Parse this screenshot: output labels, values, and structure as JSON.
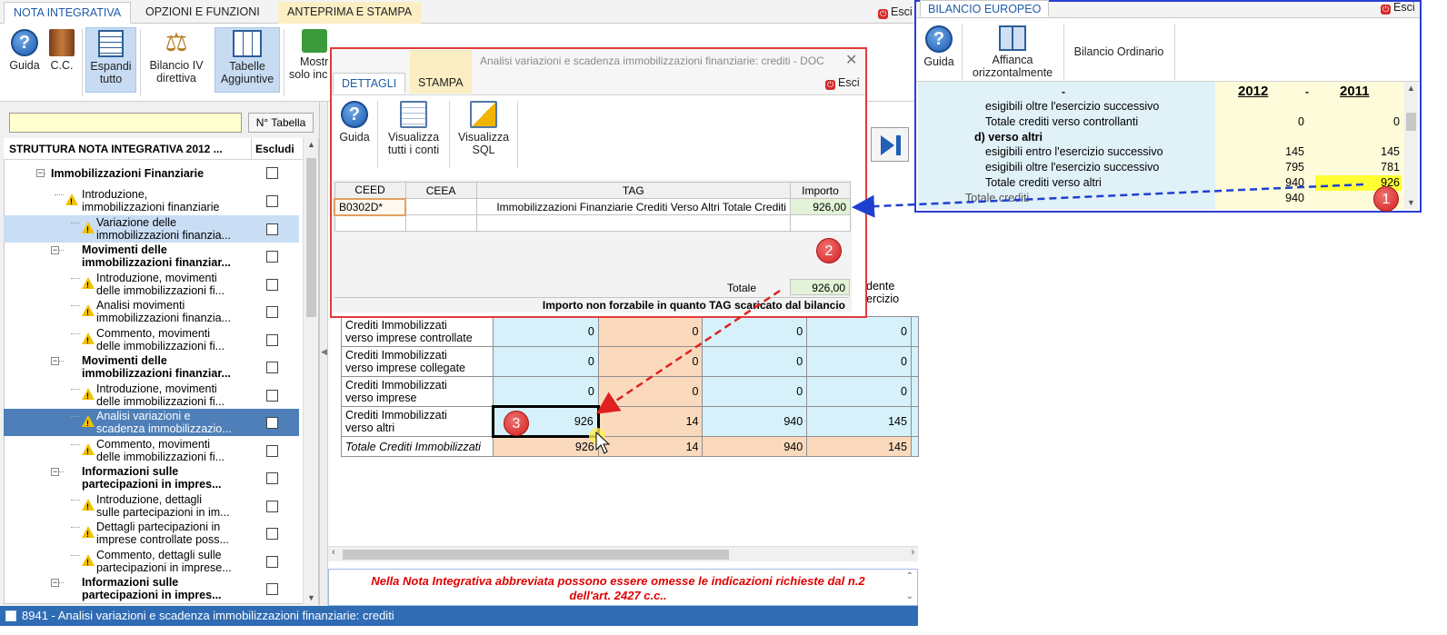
{
  "main": {
    "tabs": [
      "NOTA INTEGRATIVA",
      "OPZIONI E FUNZIONI",
      "ANTEPRIMA E STAMPA"
    ],
    "esci": "Esci",
    "ribbon": {
      "guida": "Guida",
      "cc": "C.C.",
      "espandi_l1": "Espandi",
      "espandi_l2": "tutto",
      "bilancio_l1": "Bilancio IV",
      "bilancio_l2": "direttiva",
      "tabelle_l1": "Tabelle",
      "tabelle_l2": "Aggiuntive",
      "mostra_l1": "Mostr",
      "mostra_l2": "solo inc"
    }
  },
  "tree": {
    "search_placeholder": "",
    "ntabella_label": "N° Tabella",
    "header_title": "STRUTTURA NOTA INTEGRATIVA 2012 ...",
    "header_escludi": "Escludi",
    "items": [
      {
        "l1": "Immobilizzazioni Finanziarie",
        "l2": "",
        "level": 1,
        "bold": true,
        "warn": false
      },
      {
        "l1": "Introduzione,",
        "l2": "immobilizzazioni finanziarie",
        "level": 2,
        "bold": false,
        "warn": true
      },
      {
        "l1": "Variazione delle",
        "l2": "immobilizzazioni finanzia...",
        "level": 3,
        "bold": false,
        "warn": true
      },
      {
        "l1": "Movimenti delle",
        "l2": "immobilizzazioni finanziar...",
        "level": 2,
        "bold": true,
        "warn": false
      },
      {
        "l1": "Introduzione, movimenti",
        "l2": "delle immobilizzazioni fi...",
        "level": 3,
        "bold": false,
        "warn": true
      },
      {
        "l1": "Analisi movimenti",
        "l2": "immobilizzazioni finanzia...",
        "level": 3,
        "bold": false,
        "warn": true
      },
      {
        "l1": "Commento, movimenti",
        "l2": "delle immobilizzazioni fi...",
        "level": 3,
        "bold": false,
        "warn": true
      },
      {
        "l1": "Movimenti delle",
        "l2": "immobilizzazioni finanziar...",
        "level": 2,
        "bold": true,
        "warn": false
      },
      {
        "l1": "Introduzione, movimenti",
        "l2": "delle immobilizzazioni fi...",
        "level": 3,
        "bold": false,
        "warn": true
      },
      {
        "l1": "Analisi variazioni e",
        "l2": "scadenza immobilizzazio...",
        "level": 3,
        "bold": false,
        "warn": true
      },
      {
        "l1": "Commento, movimenti",
        "l2": "delle immobilizzazioni fi...",
        "level": 3,
        "bold": false,
        "warn": true
      },
      {
        "l1": "Informazioni sulle",
        "l2": "partecipazioni  in  impres...",
        "level": 2,
        "bold": true,
        "warn": false
      },
      {
        "l1": "Introduzione, dettagli",
        "l2": "sulle partecipazioni in im...",
        "level": 3,
        "bold": false,
        "warn": true
      },
      {
        "l1": "Dettagli partecipazioni in",
        "l2": "imprese controllate poss...",
        "level": 3,
        "bold": false,
        "warn": true
      },
      {
        "l1": "Commento, dettagli sulle",
        "l2": "partecipazioni in imprese...",
        "level": 3,
        "bold": false,
        "warn": true
      },
      {
        "l1": "Informazioni sulle",
        "l2": "partecipazioni  in  impres...",
        "level": 2,
        "bold": true,
        "warn": false
      }
    ]
  },
  "credits_table": {
    "partial_header_l1": "dente",
    "partial_header_l2": "ercizio",
    "rows": [
      {
        "label_l1": "Crediti Immobilizzati",
        "label_l2": "verso imprese controllate",
        "c1": "0",
        "c2": "0",
        "c3": "0",
        "c4": "0"
      },
      {
        "label_l1": "Crediti Immobilizzati",
        "label_l2": "verso imprese collegate",
        "c1": "0",
        "c2": "0",
        "c3": "0",
        "c4": "0"
      },
      {
        "label_l1": "Crediti Immobilizzati",
        "label_l2": "verso imprese",
        "c1": "0",
        "c2": "0",
        "c3": "0",
        "c4": "0"
      },
      {
        "label_l1": "Crediti Immobilizzati",
        "label_l2": "verso altri",
        "c1": "926",
        "c2": "14",
        "c3": "940",
        "c4": "145"
      },
      {
        "label_l1": "Totale Crediti Immobilizzati",
        "label_l2": "",
        "c1": "926",
        "c2": "14",
        "c3": "940",
        "c4": "145"
      }
    ]
  },
  "note": {
    "line1": "Nella Nota Integrativa abbreviata possono essere omesse le indicazioni richieste dal n.2",
    "line2": "dell'art. 2427 c.c.."
  },
  "status_bar": "8941 - Analisi variazioni e scadenza immobilizzazioni finanziarie: crediti",
  "dialog": {
    "title": "Analisi variazioni e scadenza immobilizzazioni finanziarie: crediti - DOC",
    "tabs": [
      "DETTAGLI",
      "STAMPA"
    ],
    "esci": "Esci",
    "ribbon": {
      "guida": "Guida",
      "vis_conti_l1": "Visualizza",
      "vis_conti_l2": "tutti i conti",
      "vis_sql_l1": "Visualizza",
      "vis_sql_l2": "SQL"
    },
    "columns": [
      "CEED",
      "CEEA",
      "TAG",
      "Importo"
    ],
    "row": {
      "ceed": "B0302D*",
      "ceea": "",
      "tag": "Immobilizzazioni Finanziarie Crediti Verso Altri Totale Crediti",
      "importo": "926,00"
    },
    "totale_label": "Totale",
    "totale_value": "926,00",
    "note": "Importo non forzabile in quanto TAG scaricato dal bilancio"
  },
  "bilancio_europeo": {
    "tab": "BILANCIO EUROPEO",
    "esci": "Esci",
    "ribbon": {
      "guida": "Guida",
      "affianca_l1": "Affianca",
      "affianca_l2": "orizzontalmente",
      "bilancio_ordinario": "Bilancio Ordinario"
    },
    "header_dash1": "-",
    "header_dash2": "-",
    "year1": "2012",
    "year2": "2011",
    "rows": [
      {
        "label": "esigibili oltre l'esercizio successivo",
        "v1": "",
        "v2": "",
        "bold": false,
        "indent": 2
      },
      {
        "label": "Totale crediti verso controllanti",
        "v1": "0",
        "v2": "0",
        "bold": false,
        "indent": 2
      },
      {
        "label": "d) verso altri",
        "v1": "",
        "v2": "",
        "bold": true,
        "indent": 1
      },
      {
        "label": "esigibili entro l'esercizio successivo",
        "v1": "145",
        "v2": "145",
        "bold": false,
        "indent": 2
      },
      {
        "label": "esigibili oltre l'esercizio successivo",
        "v1": "795",
        "v2": "781",
        "bold": false,
        "indent": 2
      },
      {
        "label": "Totale crediti verso altri",
        "v1": "940",
        "v2": "926",
        "bold": false,
        "indent": 2
      },
      {
        "label": "Totale crediti",
        "v1": "940",
        "v2": "",
        "bold": false,
        "indent": 0
      }
    ]
  },
  "annotations": {
    "badge1": "1",
    "badge2": "2",
    "badge3": "3"
  },
  "colors": {
    "accent_blue": "#1e5aa8",
    "dialog_border": "#e33a3a",
    "panel_border": "#2a3fd0",
    "highlight_yellow": "#ffff33",
    "note_red": "#e00000"
  }
}
